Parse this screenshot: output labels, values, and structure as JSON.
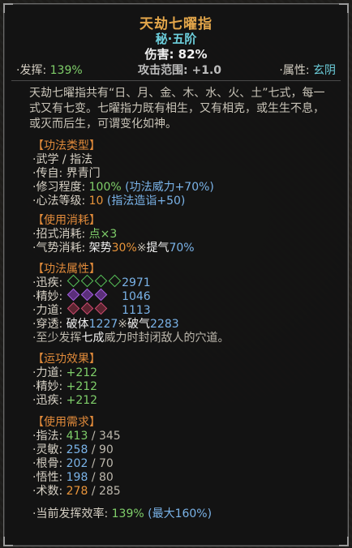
{
  "skill": {
    "name": "天劫七曜指",
    "rank": "秘·五阶",
    "damage": "伤害: 82%"
  },
  "stats": {
    "performance_label": "·发挥:",
    "performance_value": "139%",
    "range_label": "攻击范围: +1.0",
    "attribute_label": "·属性:",
    "attribute_value": "玄阴"
  },
  "description": "天劫七曜指共有“日、月、金、木、水、火、土”七式，每一式又有七变。七曜指力既有相生，又有相克，或生生不息，或灭而后生，可谓变化如神。",
  "type_section": {
    "header": "【功法类型】",
    "category": "·武学 / 指法",
    "source": "·传自: 界青门",
    "cultivation_label": "·修习程度:",
    "cultivation_value": "100%",
    "cultivation_bonus": "(功法威力+70%)",
    "heart_label": "·心法等级:",
    "heart_value": "10",
    "heart_bonus": "(指法造诣+50)"
  },
  "cost_section": {
    "header": "【使用消耗】",
    "moves_label": "·招式消耗:",
    "moves_value": "点×3",
    "qi_label": "·气势消耗:",
    "qi_a": "架势",
    "qi_a_value": "30%",
    "qi_sep": "※",
    "qi_b": "提气",
    "qi_b_value": "70%"
  },
  "attr_section": {
    "header": "【功法属性】",
    "rows": [
      {
        "label": "·迅疾:",
        "value": "2971",
        "color": "green"
      },
      {
        "label": "·精妙:",
        "value": "1046",
        "color": "purple"
      },
      {
        "label": "·力道:",
        "value": "1113",
        "color": "red"
      }
    ],
    "pierce_label": "·穿透:",
    "pierce_a": "破体",
    "pierce_a_value": "1227",
    "pierce_sep": "※",
    "pierce_b": "破气",
    "pierce_b_value": "2283",
    "effect_pre": "·至少发挥",
    "effect_key": "七成",
    "effect_post": "威力时封闭敌人的穴道。"
  },
  "effect_section": {
    "header": "【运功效果】",
    "rows": [
      {
        "label": "·力道:",
        "value": "+212"
      },
      {
        "label": "·精妙:",
        "value": "+212"
      },
      {
        "label": "·迅疾:",
        "value": "+212"
      }
    ]
  },
  "req_section": {
    "header": "【使用需求】",
    "rows": [
      {
        "label": "·指法:",
        "value": "413",
        "req": "/ 345"
      },
      {
        "label": "·灵敏:",
        "value": "258",
        "req": "/ 90"
      },
      {
        "label": "·根骨:",
        "value": "202",
        "req": "/ 70"
      },
      {
        "label": "·悟性:",
        "value": "198",
        "req": "/ 80"
      },
      {
        "label": "·术数:",
        "value": "278",
        "req": "/ 285"
      }
    ]
  },
  "efficiency": {
    "label": "·当前发挥效率:",
    "value": "139%",
    "max": "(最大160%)"
  }
}
